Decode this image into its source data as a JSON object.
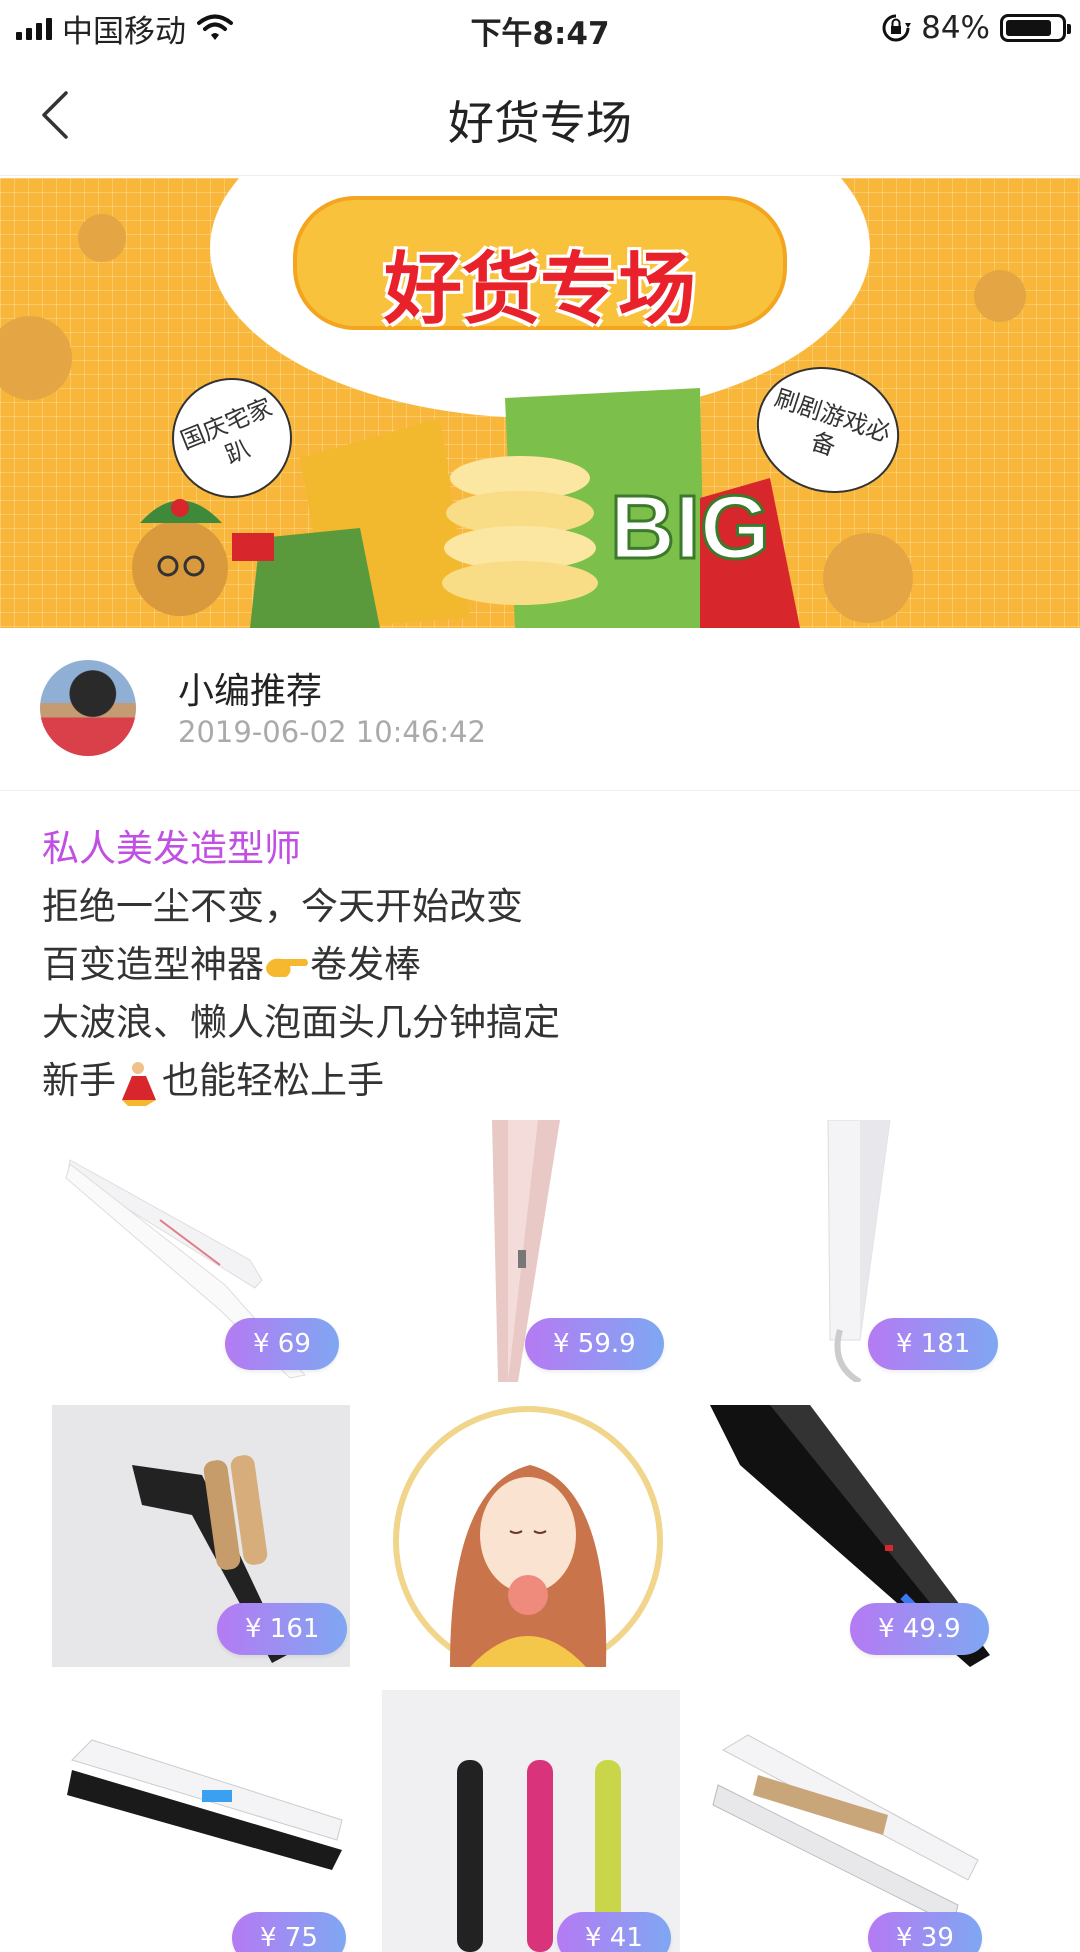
{
  "status_bar": {
    "carrier": "中国移动",
    "time": "下午8:47",
    "battery": "84%",
    "battery_level": 0.84
  },
  "nav": {
    "title": "好货专场"
  },
  "banner": {
    "title": "好货专场",
    "bubble_left": "国庆宅家趴",
    "bubble_right": "刷剧游戏必备"
  },
  "author": {
    "name": "小编推荐",
    "time": "2019-06-02 10:46:42"
  },
  "post": {
    "title": "私人美发造型师",
    "line1": "拒绝一尘不变，今天开始改变",
    "line2a": "百变造型神器",
    "line2b": "卷发棒",
    "line3": "大波浪、懒人泡面头几分钟搞定",
    "line4a": "新手",
    "line4b": "也能轻松上手"
  },
  "products": [
    {
      "price": "¥ 69"
    },
    {
      "price": "¥ 59.9"
    },
    {
      "price": "¥ 181"
    },
    {
      "price": "¥ 161"
    },
    {
      "price": ""
    },
    {
      "price": "¥ 49.9"
    },
    {
      "price": "¥ 75"
    },
    {
      "price": "¥ 41"
    },
    {
      "price": "¥ 39"
    }
  ]
}
